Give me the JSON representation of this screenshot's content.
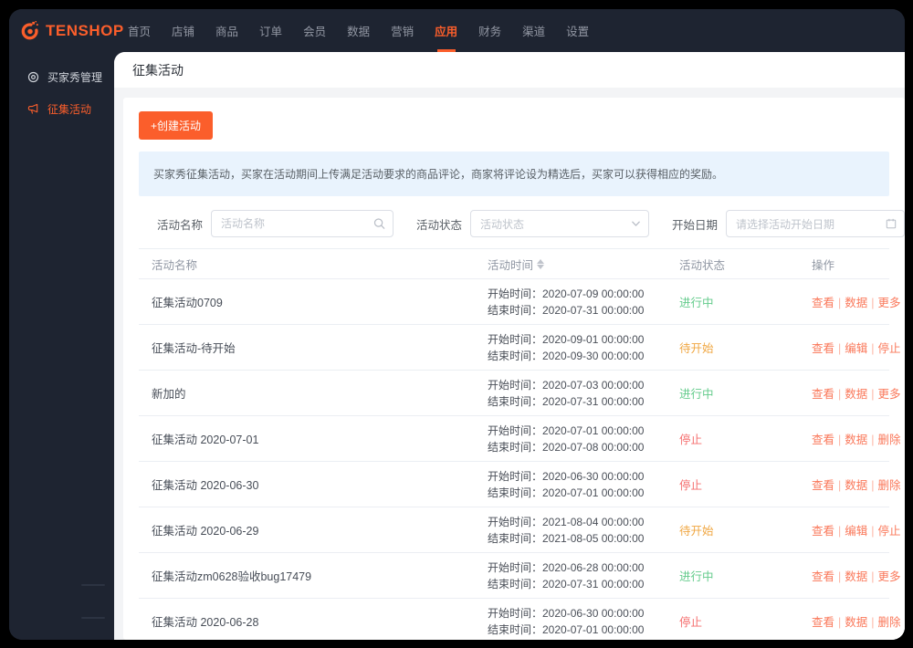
{
  "colors": {
    "accent": "#fb5e2b",
    "success": "#63cb8b",
    "warning": "#f0a742",
    "danger": "#f56c6c",
    "link": "#fa785a",
    "notice_bg": "#e9f3fd",
    "nav_bg": "#1e2431"
  },
  "brand": {
    "name": "TENSHOP"
  },
  "topnav": {
    "items": [
      "首页",
      "店铺",
      "商品",
      "订单",
      "会员",
      "数据",
      "营销",
      "应用",
      "财务",
      "渠道",
      "设置"
    ],
    "active_index": 7
  },
  "sidebar": {
    "items": [
      {
        "label": "买家秀管理",
        "icon": "target-icon",
        "active": false
      },
      {
        "label": "征集活动",
        "icon": "megaphone-icon",
        "active": true
      }
    ]
  },
  "page": {
    "title": "征集活动"
  },
  "toolbar": {
    "create_label": "+创建活动"
  },
  "notice": {
    "text": "买家秀征集活动，买家在活动期间上传满足活动要求的商品评论，商家将评论设为精选后，买家可以获得相应的奖励。"
  },
  "filters": {
    "name": {
      "label": "活动名称",
      "placeholder": "活动名称"
    },
    "status": {
      "label": "活动状态",
      "placeholder": "活动状态"
    },
    "date": {
      "label": "开始日期",
      "placeholder": "请选择活动开始日期"
    }
  },
  "table": {
    "headers": [
      "活动名称",
      "活动时间",
      "活动状态",
      "操作"
    ],
    "sortable_header_index": 1,
    "time_labels": {
      "start": "开始时间：",
      "end": "结束时间："
    },
    "rows": [
      {
        "name": "征集活动0709",
        "start": "2020-07-09 00:00:00",
        "end": "2020-07-31 00:00:00",
        "status": {
          "label": "进行中",
          "type": "running"
        },
        "actions": [
          "查看",
          "数据",
          "更多"
        ]
      },
      {
        "name": "征集活动-待开始",
        "start": "2020-09-01 00:00:00",
        "end": "2020-09-30 00:00:00",
        "status": {
          "label": "待开始",
          "type": "pending"
        },
        "actions": [
          "查看",
          "编辑",
          "停止"
        ]
      },
      {
        "name": "新加的",
        "start": "2020-07-03 00:00:00",
        "end": "2020-07-31 00:00:00",
        "status": {
          "label": "进行中",
          "type": "running"
        },
        "actions": [
          "查看",
          "数据",
          "更多"
        ]
      },
      {
        "name": "征集活动 2020-07-01",
        "start": "2020-07-01 00:00:00",
        "end": "2020-07-08 00:00:00",
        "status": {
          "label": "停止",
          "type": "stopped"
        },
        "actions": [
          "查看",
          "数据",
          "删除"
        ]
      },
      {
        "name": "征集活动 2020-06-30",
        "start": "2020-06-30 00:00:00",
        "end": "2020-07-01 00:00:00",
        "status": {
          "label": "停止",
          "type": "stopped"
        },
        "actions": [
          "查看",
          "数据",
          "删除"
        ]
      },
      {
        "name": "征集活动 2020-06-29",
        "start": "2021-08-04 00:00:00",
        "end": "2021-08-05 00:00:00",
        "status": {
          "label": "待开始",
          "type": "pending"
        },
        "actions": [
          "查看",
          "编辑",
          "停止"
        ]
      },
      {
        "name": "征集活动zm0628验收bug17479",
        "start": "2020-06-28 00:00:00",
        "end": "2020-07-31 00:00:00",
        "status": {
          "label": "进行中",
          "type": "running"
        },
        "actions": [
          "查看",
          "数据",
          "更多"
        ]
      },
      {
        "name": "征集活动 2020-06-28",
        "start": "2020-06-30 00:00:00",
        "end": "2020-07-01 00:00:00",
        "status": {
          "label": "停止",
          "type": "stopped"
        },
        "actions": [
          "查看",
          "数据",
          "删除"
        ]
      }
    ]
  }
}
